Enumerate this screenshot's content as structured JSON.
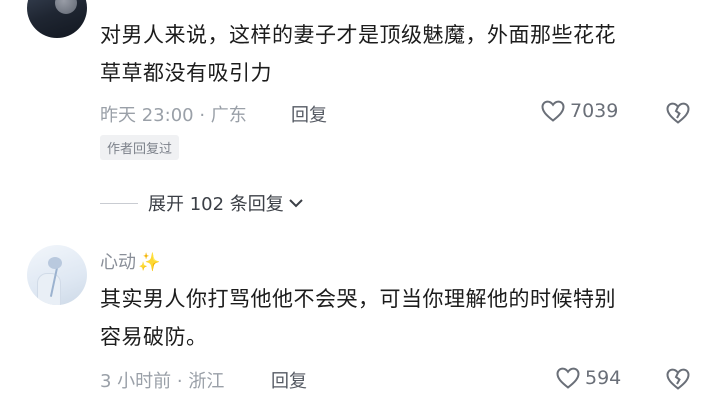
{
  "comments": [
    {
      "username": "",
      "text_line1": "对男人来说，这样的妻子才是顶级魅魔，外面那些花花",
      "text_line2": "草草都没有吸引力",
      "meta": "昨天 23:00 · 广东",
      "reply_label": "回复",
      "likes": "7039",
      "author_badge": "作者回复过",
      "avatar_icon": "night-sky-avatar"
    },
    {
      "username": "心动",
      "username_emoji": "✨",
      "text_line1": "其实男人你打骂他他不会哭，可当你理解他的时候特别",
      "text_line2": "容易破防。",
      "meta": "3 小时前 · 浙江",
      "reply_label": "回复",
      "likes": "594",
      "avatar_icon": "flower-avatar"
    }
  ],
  "thread": {
    "expand_label": "展开 102 条回复"
  },
  "icons": {
    "like": "heart-outline-icon",
    "dislike": "broken-heart-icon",
    "expand": "chevron-down-icon"
  },
  "colors": {
    "meta_gray": "#9aa0a8",
    "sparkle": "#e9b93d"
  }
}
